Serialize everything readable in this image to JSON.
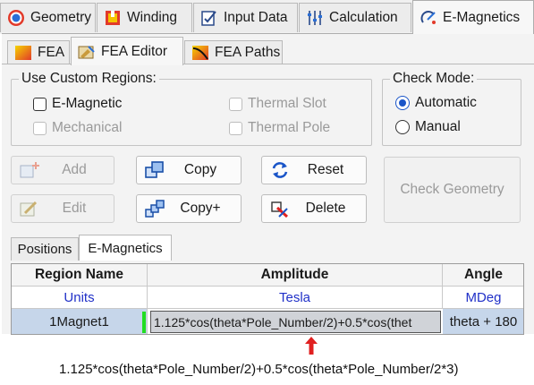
{
  "top_tabs": [
    {
      "label": "Geometry",
      "icon": "geometry-icon"
    },
    {
      "label": "Winding",
      "icon": "winding-icon"
    },
    {
      "label": "Input Data",
      "icon": "input-data-icon"
    },
    {
      "label": "Calculation",
      "icon": "calculation-icon"
    },
    {
      "label": "E-Magnetics",
      "icon": "emagnetics-icon",
      "active": true
    }
  ],
  "sub_tabs": [
    {
      "label": "FEA",
      "icon": "fea-icon"
    },
    {
      "label": "FEA Editor",
      "icon": "fea-editor-icon",
      "active": true
    },
    {
      "label": "FEA Paths",
      "icon": "fea-paths-icon"
    }
  ],
  "custom_regions": {
    "title": "Use Custom Regions:",
    "items": [
      {
        "label": "E-Magnetic",
        "checked": false,
        "enabled": true
      },
      {
        "label": "Mechanical",
        "checked": false,
        "enabled": false
      },
      {
        "label": "Thermal Slot",
        "checked": false,
        "enabled": false
      },
      {
        "label": "Thermal Pole",
        "checked": false,
        "enabled": false
      }
    ]
  },
  "check_mode": {
    "title": "Check Mode:",
    "options": [
      {
        "label": "Automatic",
        "selected": true
      },
      {
        "label": "Manual",
        "selected": false
      }
    ]
  },
  "buttons": {
    "add": "Add",
    "edit": "Edit",
    "copy": "Copy",
    "copy_plus": "Copy+",
    "reset": "Reset",
    "delete": "Delete",
    "check_geometry": "Check Geometry"
  },
  "inner_tabs": [
    {
      "label": "Positions"
    },
    {
      "label": "E-Magnetics",
      "active": true
    }
  ],
  "grid": {
    "headers": [
      "Region Name",
      "Amplitude",
      "Angle"
    ],
    "units": [
      "Units",
      "Tesla",
      "MDeg"
    ],
    "rows": [
      {
        "region": "1Magnet1",
        "amplitude": "1.125*cos(theta*Pole_Number/2)+0.5*cos(thet",
        "angle": "theta + 180"
      }
    ]
  },
  "annotation": {
    "formula": "1.125*cos(theta*Pole_Number/2)+0.5*cos(theta*Pole_Number/2*3)"
  },
  "colors": {
    "accent": "#1a55c8",
    "units_text": "#2030c8",
    "selected_row": "#c6d6ea",
    "row_marker": "#22dd22",
    "arrow": "#e02020"
  }
}
